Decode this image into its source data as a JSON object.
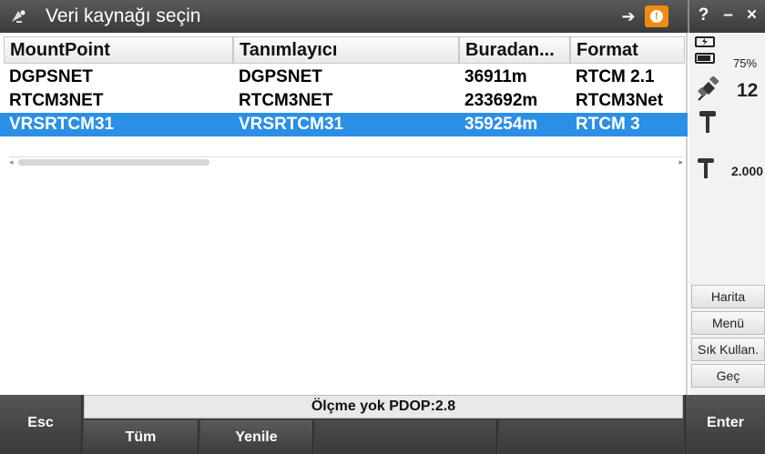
{
  "window": {
    "title": "Veri kaynağı seçin",
    "help_label": "?",
    "minimize_label": "–",
    "close_label": "×",
    "status_icons": [
      "login-arrow-icon",
      "warning-icon"
    ],
    "warning_color": "#f08a10"
  },
  "table": {
    "columns": [
      "MountPoint",
      "Tanımlayıcı",
      "Buradan...",
      "Format"
    ],
    "rows": [
      {
        "mountpoint": "DGPSNET",
        "identifier": "DGPSNET",
        "distance": "36911m",
        "format": "RTCM 2.1",
        "selected": false
      },
      {
        "mountpoint": "RTCM3NET",
        "identifier": "RTCM3NET",
        "distance": "233692m",
        "format": "RTCM3Net",
        "selected": false
      },
      {
        "mountpoint": "VRSRTCM31",
        "identifier": "VRSRTCM31",
        "distance": "359254m",
        "format": "RTCM 3",
        "selected": true
      }
    ],
    "selected_color": "#2b8fe6"
  },
  "side": {
    "battery_percent": "75%",
    "satellite_count": "12",
    "antenna_height": "2.000",
    "buttons": [
      "Harita",
      "Menü",
      "Sık Kullan.",
      "Geç"
    ]
  },
  "bottom": {
    "status_text": "Ölçme yok  PDOP:2.8",
    "esc_label": "Esc",
    "all_label": "Tüm",
    "refresh_label": "Yenile",
    "enter_label": "Enter"
  }
}
